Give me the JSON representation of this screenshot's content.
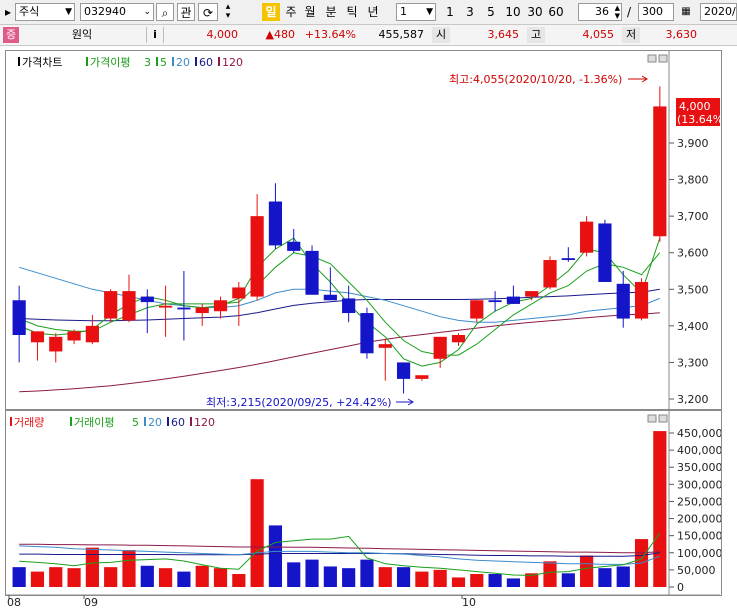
{
  "toolbar": {
    "market": "주식",
    "code": "032940",
    "btn_related": "관",
    "period_active": "일",
    "periods": [
      "주",
      "월",
      "분",
      "틱",
      "년"
    ],
    "interval_value": "1",
    "nums": [
      "1",
      "3",
      "5",
      "10",
      "30",
      "60"
    ],
    "count_value": "36",
    "slash": "/",
    "total": "300",
    "date": "2020/"
  },
  "infobar": {
    "badge": "증",
    "name": "원익",
    "info_btn": "i",
    "price": "4,000",
    "change": "▲480",
    "change_pct": "+13.64%",
    "volume": "455,587",
    "open_label": "시",
    "open": "3,645",
    "high_label": "고",
    "high": "4,055",
    "low_label": "저",
    "low": "3,630"
  },
  "price_panel": {
    "legend_title": "가격차트",
    "legend_ma": "가격이평",
    "legend_items": [
      "3",
      "5",
      "20",
      "60",
      "120"
    ],
    "high_annotation": "최고:4,055(2020/10/20, -1.36%)",
    "low_annotation": "최저:3,215(2020/09/25, +24.42%)",
    "current_price": "4,000",
    "current_pct": "(13.64%)"
  },
  "volume_panel": {
    "legend_title": "거래량",
    "legend_ma": "거래이평",
    "legend_items": [
      "5",
      "20",
      "60",
      "120"
    ]
  },
  "x_labels": [
    "08",
    "09",
    "10"
  ],
  "colors": {
    "up": "#e81010",
    "down": "#1414c8",
    "ma3": "#1a9c1a",
    "ma5": "#1aa11a",
    "ma20": "#3c8ccc",
    "ma60": "#1a1a8c",
    "ma120": "#8c1a4a"
  },
  "chart_data": [
    {
      "type": "candlestick",
      "title": "가격차트",
      "ylim": [
        3180,
        4100
      ],
      "y_ticks": [
        "3,900",
        "3,800",
        "3,700",
        "3,600",
        "3,500",
        "3,400",
        "3,300",
        "3,200"
      ],
      "candles": [
        {
          "o": 3470,
          "h": 3510,
          "l": 3300,
          "c": 3375
        },
        {
          "o": 3355,
          "h": 3385,
          "l": 3305,
          "c": 3385
        },
        {
          "o": 3330,
          "h": 3380,
          "l": 3300,
          "c": 3370
        },
        {
          "o": 3360,
          "h": 3390,
          "l": 3350,
          "c": 3385
        },
        {
          "o": 3355,
          "h": 3430,
          "l": 3350,
          "c": 3400
        },
        {
          "o": 3420,
          "h": 3500,
          "l": 3410,
          "c": 3495
        },
        {
          "o": 3415,
          "h": 3540,
          "l": 3410,
          "c": 3495
        },
        {
          "o": 3480,
          "h": 3500,
          "l": 3380,
          "c": 3465
        },
        {
          "o": 3450,
          "h": 3510,
          "l": 3370,
          "c": 3455
        },
        {
          "o": 3450,
          "h": 3550,
          "l": 3360,
          "c": 3445
        },
        {
          "o": 3435,
          "h": 3460,
          "l": 3400,
          "c": 3450
        },
        {
          "o": 3440,
          "h": 3480,
          "l": 3420,
          "c": 3470
        },
        {
          "o": 3475,
          "h": 3520,
          "l": 3400,
          "c": 3505
        },
        {
          "o": 3480,
          "h": 3760,
          "l": 3470,
          "c": 3700
        },
        {
          "o": 3740,
          "h": 3790,
          "l": 3610,
          "c": 3620
        },
        {
          "o": 3630,
          "h": 3665,
          "l": 3600,
          "c": 3605
        },
        {
          "o": 3605,
          "h": 3620,
          "l": 3490,
          "c": 3485
        },
        {
          "o": 3485,
          "h": 3560,
          "l": 3470,
          "c": 3470
        },
        {
          "o": 3475,
          "h": 3510,
          "l": 3410,
          "c": 3435
        },
        {
          "o": 3435,
          "h": 3450,
          "l": 3310,
          "c": 3325
        },
        {
          "o": 3340,
          "h": 3365,
          "l": 3250,
          "c": 3350
        },
        {
          "o": 3300,
          "h": 3300,
          "l": 3215,
          "c": 3255
        },
        {
          "o": 3255,
          "h": 3265,
          "l": 3250,
          "c": 3265
        },
        {
          "o": 3310,
          "h": 3370,
          "l": 3285,
          "c": 3370
        },
        {
          "o": 3355,
          "h": 3380,
          "l": 3345,
          "c": 3375
        },
        {
          "o": 3420,
          "h": 3470,
          "l": 3410,
          "c": 3470
        },
        {
          "o": 3470,
          "h": 3495,
          "l": 3440,
          "c": 3465
        },
        {
          "o": 3480,
          "h": 3510,
          "l": 3460,
          "c": 3460
        },
        {
          "o": 3480,
          "h": 3495,
          "l": 3470,
          "c": 3495
        },
        {
          "o": 3505,
          "h": 3590,
          "l": 3500,
          "c": 3580
        },
        {
          "o": 3585,
          "h": 3615,
          "l": 3575,
          "c": 3580
        },
        {
          "o": 3600,
          "h": 3700,
          "l": 3590,
          "c": 3685
        },
        {
          "o": 3680,
          "h": 3690,
          "l": 3520,
          "c": 3520
        },
        {
          "o": 3515,
          "h": 3550,
          "l": 3395,
          "c": 3420
        },
        {
          "o": 3420,
          "h": 3530,
          "l": 3415,
          "c": 3520
        },
        {
          "o": 3645,
          "h": 4055,
          "l": 3630,
          "c": 4000
        }
      ],
      "ma3": [
        3400,
        3380,
        3375,
        3380,
        3390,
        3430,
        3460,
        3480,
        3470,
        3455,
        3450,
        3455,
        3475,
        3560,
        3610,
        3640,
        3570,
        3520,
        3460,
        3410,
        3370,
        3310,
        3290,
        3300,
        3335,
        3405,
        3440,
        3465,
        3475,
        3510,
        3550,
        3610,
        3600,
        3540,
        3490,
        3640
      ],
      "ma5": [
        3420,
        3400,
        3390,
        3385,
        3385,
        3410,
        3430,
        3450,
        3460,
        3460,
        3460,
        3460,
        3465,
        3510,
        3560,
        3600,
        3590,
        3570,
        3520,
        3470,
        3410,
        3360,
        3330,
        3320,
        3320,
        3350,
        3390,
        3430,
        3460,
        3490,
        3510,
        3550,
        3570,
        3560,
        3540,
        3600
      ],
      "ma20": [
        3560,
        3545,
        3530,
        3515,
        3500,
        3490,
        3480,
        3470,
        3460,
        3455,
        3450,
        3450,
        3455,
        3470,
        3490,
        3500,
        3500,
        3495,
        3490,
        3480,
        3470,
        3455,
        3440,
        3425,
        3415,
        3410,
        3410,
        3415,
        3420,
        3425,
        3430,
        3440,
        3445,
        3450,
        3455,
        3475
      ],
      "ma60": [
        3420,
        3418,
        3416,
        3415,
        3414,
        3414,
        3415,
        3416,
        3418,
        3420,
        3422,
        3424,
        3428,
        3436,
        3446,
        3456,
        3462,
        3466,
        3470,
        3472,
        3472,
        3472,
        3472,
        3472,
        3472,
        3473,
        3474,
        3476,
        3478,
        3480,
        3482,
        3485,
        3488,
        3490,
        3492,
        3500
      ],
      "ma120": [
        3220,
        3222,
        3225,
        3228,
        3232,
        3236,
        3242,
        3248,
        3255,
        3262,
        3270,
        3278,
        3286,
        3295,
        3305,
        3315,
        3325,
        3335,
        3345,
        3355,
        3363,
        3370,
        3376,
        3382,
        3388,
        3394,
        3400,
        3405,
        3410,
        3414,
        3418,
        3422,
        3426,
        3430,
        3432,
        3436
      ]
    },
    {
      "type": "bar",
      "title": "거래량",
      "ylim": [
        0,
        460000
      ],
      "y_ticks": [
        "450,000",
        "400,000",
        "350,000",
        "300,000",
        "250,000",
        "200,000",
        "150,000",
        "100,000",
        "50,000",
        "0"
      ],
      "values": [
        58000,
        45000,
        58000,
        55000,
        115000,
        58000,
        108000,
        62000,
        55000,
        45000,
        62000,
        55000,
        38000,
        315000,
        180000,
        72000,
        80000,
        60000,
        55000,
        80000,
        58000,
        58000,
        45000,
        50000,
        28000,
        38000,
        38000,
        25000,
        40000,
        75000,
        40000,
        92000,
        55000,
        60000,
        140000,
        455587
      ],
      "vma5": [
        75000,
        72000,
        68000,
        62000,
        70000,
        72000,
        78000,
        80000,
        82000,
        76000,
        65000,
        55000,
        52000,
        105000,
        130000,
        135000,
        140000,
        140000,
        148000,
        85000,
        68000,
        62000,
        58000,
        55000,
        50000,
        45000,
        40000,
        35000,
        34000,
        43000,
        45000,
        55000,
        60000,
        65000,
        82000,
        158000
      ],
      "vma20": [
        120000,
        118000,
        116000,
        112000,
        110000,
        108000,
        106000,
        104000,
        102000,
        100000,
        98000,
        96000,
        94000,
        100000,
        104000,
        104000,
        104000,
        102000,
        100000,
        100000,
        98000,
        96000,
        92000,
        88000,
        82000,
        78000,
        76000,
        74000,
        72000,
        70000,
        68000,
        68000,
        66000,
        66000,
        70000,
        90000
      ],
      "vma60": [
        96000,
        96000,
        95000,
        95000,
        95000,
        95000,
        95000,
        95000,
        95000,
        94000,
        94000,
        94000,
        94000,
        96000,
        98000,
        98000,
        98000,
        98000,
        98000,
        98000,
        98000,
        97000,
        96000,
        95000,
        94000,
        93000,
        92000,
        92000,
        91000,
        91000,
        90000,
        90000,
        90000,
        90000,
        92000,
        100000
      ],
      "vma120": [
        125000,
        125000,
        124000,
        124000,
        123000,
        123000,
        122000,
        122000,
        121000,
        120000,
        119000,
        118000,
        117000,
        117000,
        117000,
        116000,
        116000,
        115000,
        114000,
        113000,
        112000,
        111000,
        110000,
        109000,
        108000,
        107000,
        106000,
        105000,
        104000,
        103000,
        102000,
        102000,
        101000,
        100000,
        100000,
        103000
      ]
    }
  ]
}
